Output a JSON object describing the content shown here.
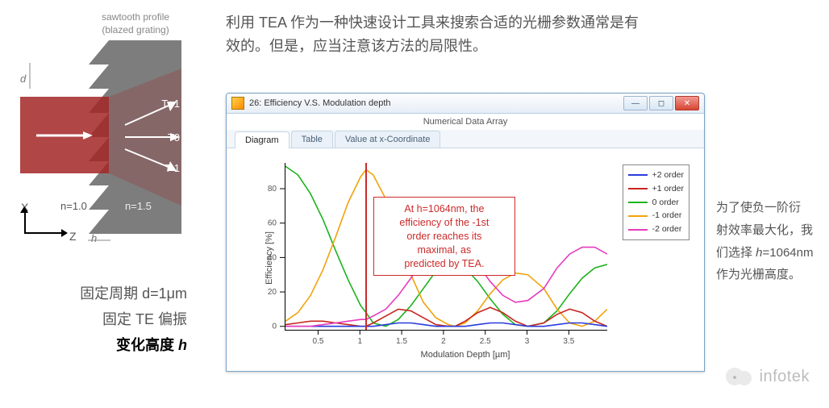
{
  "diagram": {
    "label_top": "sawtooth profile\n(blazed grating)",
    "d_label": "d",
    "h_label": "h",
    "order_p1": "T+1",
    "order_0": "T0",
    "order_m1": "T-1",
    "n_left": "n=1.0",
    "n_right": "n=1.5",
    "axis_x": "X",
    "axis_z": "Z"
  },
  "left_params": {
    "line1_pre": "固定周期 ",
    "line1_eq": "d=1μm",
    "line2": "固定 TE 偏振",
    "line3_pre": "变化高度 ",
    "line3_var": "h"
  },
  "top_paragraph": "利用 TEA 作为一种快速设计工具来搜索合适的光栅参数通常是有效的。但是，应当注意该方法的局限性。",
  "right_paragraph": {
    "l1": "为了使负一阶衍",
    "l2": "射效率最大化，我",
    "l3a": "们选择 ",
    "l3b": "h",
    "l3c": "=1064nm",
    "l4": "作为光栅高度。"
  },
  "window": {
    "title": "26: Efficiency V.S. Modulation depth",
    "subtitle": "Numerical Data Array",
    "tabs": [
      "Diagram",
      "Table",
      "Value at x-Coordinate"
    ]
  },
  "chart": {
    "ylabel": "Efficiency [%]",
    "xlabel": "Modulation Depth  [µm]",
    "yticks": [
      0,
      20,
      40,
      60,
      80
    ],
    "xticks": [
      0.5,
      1,
      1.5,
      2,
      2.5,
      3,
      3.5
    ],
    "xrange": [
      0.1,
      3.95
    ],
    "yrange": [
      -2,
      95
    ]
  },
  "legend": {
    "items": [
      {
        "label": "+2 order",
        "color": "#2a3bdc"
      },
      {
        "label": "+1 order",
        "color": "#c8261f"
      },
      {
        "label": "0 order",
        "color": "#1db31d"
      },
      {
        "label": "-1 order",
        "color": "#f2a20c"
      },
      {
        "label": "-2 order",
        "color": "#e63bbd"
      }
    ]
  },
  "callout": {
    "text": "At h=1064nm, the\nefficiency of the -1st\norder reaches its\nmaximal, as\npredicted by TEA.",
    "x_value_um": 1.064
  },
  "watermark": "infotek",
  "chart_data": {
    "type": "line",
    "title": "Efficiency V.S. Modulation depth",
    "xlabel": "Modulation Depth  [µm]",
    "ylabel": "Efficiency [%]",
    "xlim": [
      0.1,
      3.95
    ],
    "ylim": [
      -2,
      95
    ],
    "x": [
      0.1,
      0.25,
      0.4,
      0.55,
      0.7,
      0.85,
      1.0,
      1.064,
      1.15,
      1.3,
      1.45,
      1.6,
      1.75,
      1.9,
      2.05,
      2.128,
      2.25,
      2.4,
      2.55,
      2.7,
      2.85,
      3.0,
      3.192,
      3.35,
      3.5,
      3.65,
      3.8,
      3.95
    ],
    "series": [
      {
        "name": "0 order",
        "color": "#1db31d",
        "values": [
          93,
          88,
          77,
          62,
          44,
          27,
          12,
          8,
          2,
          0,
          4,
          12,
          22,
          32,
          36,
          37,
          34,
          26,
          16,
          7,
          1,
          0,
          2,
          9,
          19,
          28,
          34,
          36
        ]
      },
      {
        "name": "-1 order",
        "color": "#f2a20c",
        "values": [
          3,
          8,
          18,
          33,
          52,
          72,
          87,
          91,
          88,
          74,
          52,
          30,
          14,
          5,
          1,
          0,
          2,
          9,
          19,
          27,
          31,
          30,
          22,
          10,
          2,
          0,
          3,
          10
        ]
      },
      {
        "name": "+1 order",
        "color": "#c8261f",
        "values": [
          1,
          2,
          3,
          3,
          2,
          1,
          0,
          0,
          2,
          6,
          10,
          9,
          5,
          1,
          0,
          0,
          3,
          8,
          11,
          8,
          3,
          0,
          2,
          7,
          10,
          8,
          3,
          0
        ]
      },
      {
        "name": "+2 order",
        "color": "#2a3bdc",
        "values": [
          0,
          0,
          0,
          0,
          0,
          0,
          0,
          0,
          0,
          1,
          2,
          2,
          1,
          0,
          0,
          0,
          0,
          1,
          2,
          2,
          1,
          0,
          0,
          1,
          2,
          2,
          1,
          0
        ]
      },
      {
        "name": "-2 order",
        "color": "#e63bbd",
        "values": [
          0,
          0,
          0,
          1,
          2,
          3,
          4,
          4,
          6,
          10,
          18,
          28,
          38,
          44,
          46,
          47,
          44,
          36,
          26,
          18,
          14,
          15,
          22,
          34,
          42,
          46,
          46,
          42
        ]
      }
    ],
    "annotation": {
      "x": 1.064,
      "text": "At h=1064nm, the efficiency of the -1st order reaches its maximal, as predicted by TEA."
    }
  }
}
